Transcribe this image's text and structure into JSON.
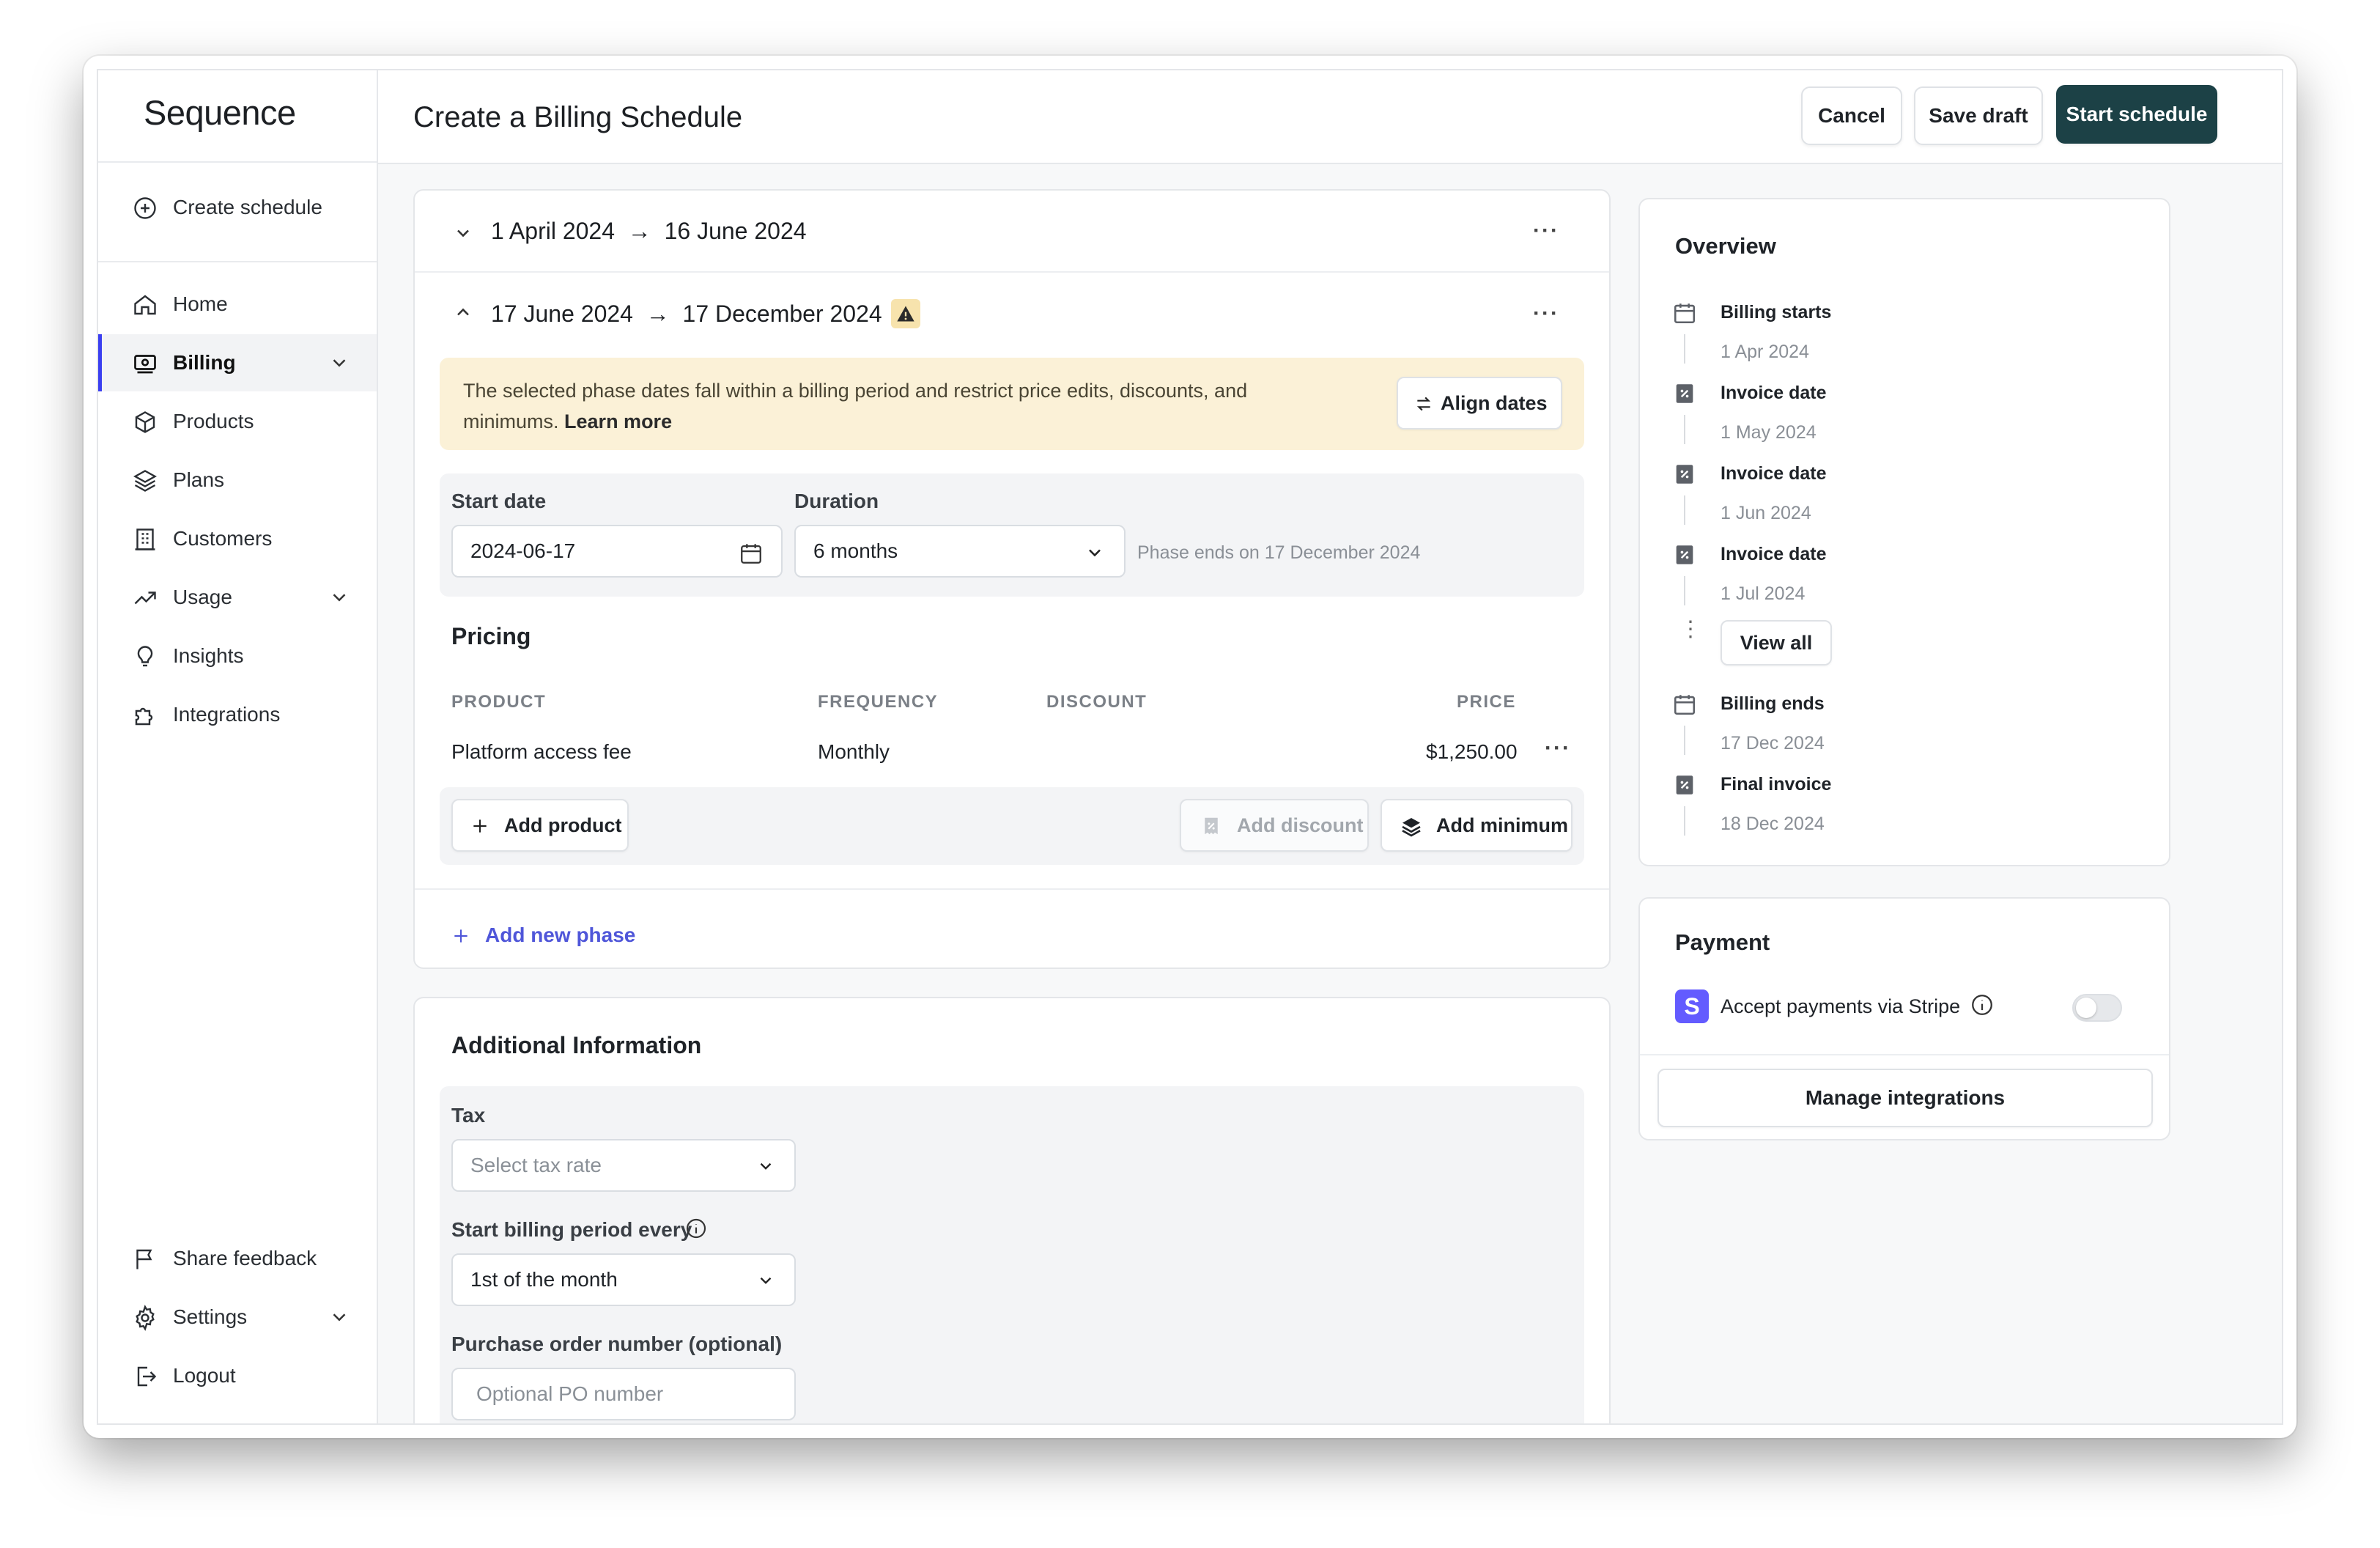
{
  "app": {
    "name": "Sequence"
  },
  "header": {
    "title": "Create a Billing Schedule",
    "cancel_label": "Cancel",
    "save_draft_label": "Save draft",
    "start_label": "Start schedule"
  },
  "sidebar": {
    "create_label": "Create schedule",
    "items": [
      {
        "label": "Home",
        "icon": "home-icon"
      },
      {
        "label": "Billing",
        "icon": "billing-icon",
        "active": true
      },
      {
        "label": "Products",
        "icon": "box-icon"
      },
      {
        "label": "Plans",
        "icon": "layers-icon"
      },
      {
        "label": "Customers",
        "icon": "building-icon"
      },
      {
        "label": "Usage",
        "icon": "trend-icon"
      },
      {
        "label": "Insights",
        "icon": "lightbulb-icon"
      },
      {
        "label": "Integrations",
        "icon": "puzzle-icon"
      }
    ],
    "bottom": [
      {
        "label": "Share feedback",
        "icon": "flag-icon"
      },
      {
        "label": "Settings",
        "icon": "gear-icon"
      },
      {
        "label": "Logout",
        "icon": "logout-icon"
      }
    ]
  },
  "phases": [
    {
      "start": "1 April 2024",
      "end": "16 June 2024",
      "arrow": "→",
      "collapsed": true
    },
    {
      "start": "17 June 2024",
      "end": "17 December 2024",
      "arrow": "→",
      "collapsed": false
    }
  ],
  "warning": {
    "text": "The selected phase dates fall within a billing period and restrict price edits, discounts, and minimums.",
    "link": "Learn more",
    "button": "Align dates"
  },
  "phase_form": {
    "start_label": "Start date",
    "start_value": "2024-06-17",
    "duration_label": "Duration",
    "duration_value": "6 months",
    "hint": "Phase ends on 17 December 2024"
  },
  "pricing": {
    "title": "Pricing",
    "columns": [
      "PRODUCT",
      "FREQUENCY",
      "DISCOUNT",
      "PRICE"
    ],
    "rows": [
      {
        "product": "Platform access fee",
        "frequency": "Monthly",
        "discount": "",
        "price": "$1,250.00"
      }
    ],
    "add_product": "Add product",
    "add_discount": "Add discount",
    "add_minimum": "Add minimum"
  },
  "add_phase_label": "Add new phase",
  "additional": {
    "title": "Additional Information",
    "tax_label": "Tax",
    "tax_placeholder": "Select tax rate",
    "period_label": "Start billing period every",
    "period_value": "1st of the month",
    "po_label": "Purchase order number (optional)",
    "po_placeholder": "Optional PO number"
  },
  "overview": {
    "title": "Overview",
    "items": [
      {
        "label": "Billing starts",
        "date": "1 Apr 2024",
        "icon": "calendar-icon"
      },
      {
        "label": "Invoice date",
        "date": "1 May 2024",
        "icon": "invoice-icon"
      },
      {
        "label": "Invoice date",
        "date": "1 Jun 2024",
        "icon": "invoice-icon"
      },
      {
        "label": "Invoice date",
        "date": "1 Jul 2024",
        "icon": "invoice-icon"
      }
    ],
    "view_all": "View all",
    "end_items": [
      {
        "label": "Billing ends",
        "date": "17 Dec 2024",
        "icon": "calendar-icon"
      },
      {
        "label": "Final invoice",
        "date": "18 Dec 2024",
        "icon": "invoice-icon"
      }
    ]
  },
  "payment": {
    "title": "Payment",
    "stripe_label": "Accept payments via Stripe",
    "stripe_badge": "S",
    "toggle_on": false,
    "manage_label": "Manage integrations"
  },
  "colors": {
    "primary": "#1c4146",
    "accent": "#4f56d9",
    "warning_bg": "#fbf1d7",
    "stripe": "#635bff"
  }
}
